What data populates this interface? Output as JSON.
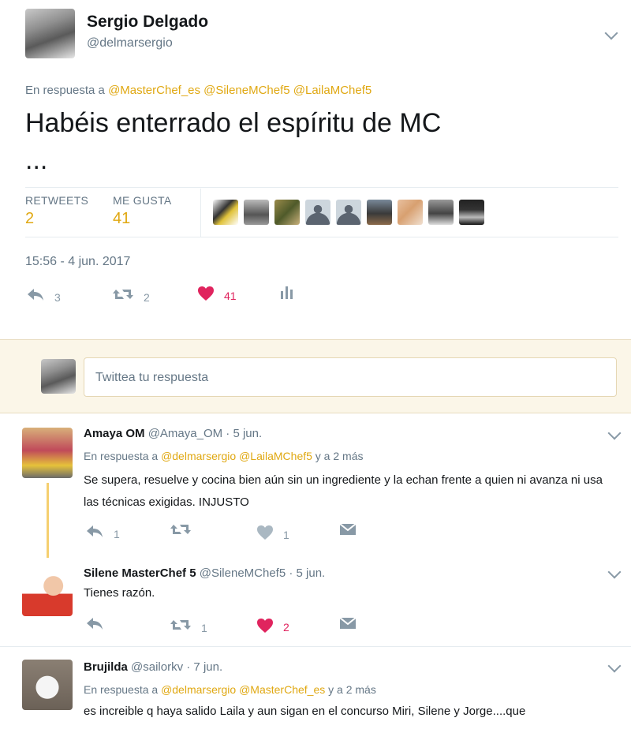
{
  "main_tweet": {
    "name": "Sergio Delgado",
    "handle": "@delmarsergio",
    "reply_prefix": "En respuesta a",
    "reply_mentions": "@MasterChef_es @SileneMChef5 @LailaMChef5",
    "text": "Habéis enterrado el espíritu de MC",
    "text2": "...",
    "retweets_label": "RETWEETS",
    "retweets_count": "2",
    "likes_label": "ME GUSTA",
    "likes_count": "41",
    "timestamp": "15:56 - 4 jun. 2017",
    "actions": {
      "reply": "3",
      "retweet": "2",
      "like": "41"
    }
  },
  "reply_box": {
    "placeholder": "Twittea tu respuesta"
  },
  "replies": [
    {
      "name": "Amaya OM",
      "handle": "@Amaya_OM",
      "time": "· 5 jun.",
      "reply_prefix": "En respuesta a",
      "reply_mentions": "@delmarsergio @LailaMChef5",
      "reply_more": "y a 2 más",
      "text": "Se supera, resuelve y cocina bien aún sin un ingrediente y la echan frente a quien ni avanza ni usa las técnicas exigidas. INJUSTO",
      "actions": {
        "reply": "1",
        "retweet": "",
        "like": "1"
      }
    },
    {
      "name": "Silene MasterChef 5",
      "handle": "@SileneMChef5",
      "time": "· 5 jun.",
      "text": "Tienes razón.",
      "actions": {
        "reply": "",
        "retweet": "1",
        "like": "2"
      }
    },
    {
      "name": "Brujilda",
      "handle": "@sailorkv",
      "time": "· 7 jun.",
      "reply_prefix": "En respuesta a",
      "reply_mentions": "@delmarsergio @MasterChef_es",
      "reply_more": "y a 2 más",
      "text": "es increible q haya salido Laila y aun sigan en el concurso Miri, Silene y Jorge....que"
    }
  ],
  "colors": {
    "accent": "#e0a812",
    "like_red": "#e0245e",
    "muted": "#657786",
    "compose_bg": "#fbf6e8"
  }
}
